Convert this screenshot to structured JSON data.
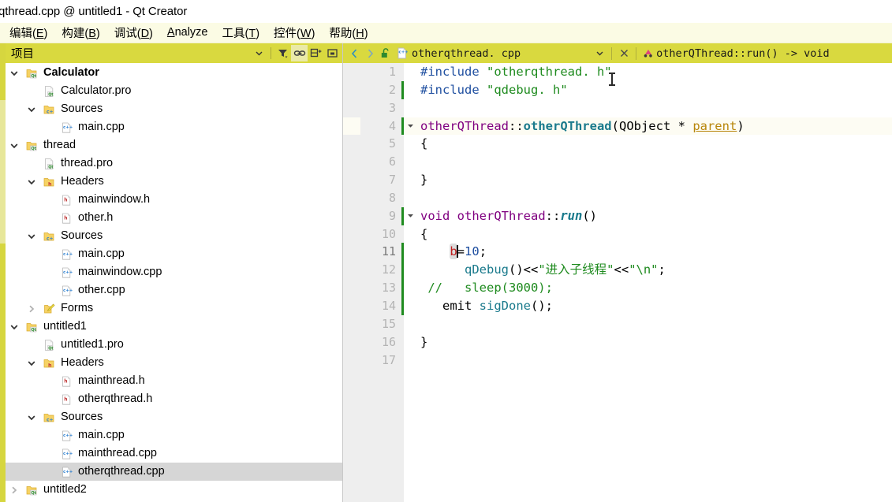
{
  "window": {
    "title": "qthread.cpp @ untitled1 - Qt Creator"
  },
  "menubar": {
    "items": [
      {
        "label": "编辑(E)",
        "mnemonic": "E"
      },
      {
        "label": "构建(B)",
        "mnemonic": "B"
      },
      {
        "label": "调试(D)",
        "mnemonic": "D"
      },
      {
        "label": "Analyze",
        "mnemonic": "A"
      },
      {
        "label": "工具(T)",
        "mnemonic": "T"
      },
      {
        "label": "控件(W)",
        "mnemonic": "W"
      },
      {
        "label": "帮助(H)",
        "mnemonic": "H"
      }
    ]
  },
  "project_panel": {
    "header": {
      "title": "项目",
      "buttons": [
        {
          "name": "combo-dropdown-icon",
          "glyph": "▾"
        },
        {
          "name": "filter-icon",
          "glyph": "filter"
        },
        {
          "name": "link-icon",
          "glyph": "link",
          "active": true
        },
        {
          "name": "expand-all-icon",
          "glyph": "expand"
        },
        {
          "name": "collapse-all-icon",
          "glyph": "collapse"
        }
      ]
    },
    "tree": [
      {
        "label": "Calculator",
        "level": 1,
        "chevron": "down",
        "icon": "qt-project",
        "bold": true,
        "selected": false
      },
      {
        "label": "Calculator.pro",
        "level": 2,
        "chevron": "none",
        "icon": "pro-file",
        "bold": false,
        "selected": false
      },
      {
        "label": "Sources",
        "level": 2,
        "chevron": "down",
        "icon": "folder-cpp",
        "bold": false,
        "selected": false
      },
      {
        "label": "main.cpp",
        "level": 3,
        "chevron": "none",
        "icon": "cpp-file",
        "bold": false,
        "selected": false
      },
      {
        "label": "thread",
        "level": 1,
        "chevron": "down",
        "icon": "qt-project",
        "bold": false,
        "selected": false
      },
      {
        "label": "thread.pro",
        "level": 2,
        "chevron": "none",
        "icon": "pro-file",
        "bold": false,
        "selected": false
      },
      {
        "label": "Headers",
        "level": 2,
        "chevron": "down",
        "icon": "folder-h",
        "bold": false,
        "selected": false
      },
      {
        "label": "mainwindow.h",
        "level": 3,
        "chevron": "none",
        "icon": "h-file",
        "bold": false,
        "selected": false
      },
      {
        "label": "other.h",
        "level": 3,
        "chevron": "none",
        "icon": "h-file",
        "bold": false,
        "selected": false
      },
      {
        "label": "Sources",
        "level": 2,
        "chevron": "down",
        "icon": "folder-cpp",
        "bold": false,
        "selected": false
      },
      {
        "label": "main.cpp",
        "level": 3,
        "chevron": "none",
        "icon": "cpp-file",
        "bold": false,
        "selected": false
      },
      {
        "label": "mainwindow.cpp",
        "level": 3,
        "chevron": "none",
        "icon": "cpp-file",
        "bold": false,
        "selected": false
      },
      {
        "label": "other.cpp",
        "level": 3,
        "chevron": "none",
        "icon": "cpp-file",
        "bold": false,
        "selected": false
      },
      {
        "label": "Forms",
        "level": 2,
        "chevron": "right",
        "icon": "folder-form",
        "bold": false,
        "selected": false
      },
      {
        "label": "untitled1",
        "level": 1,
        "chevron": "down",
        "icon": "qt-project",
        "bold": false,
        "selected": false
      },
      {
        "label": "untitled1.pro",
        "level": 2,
        "chevron": "none",
        "icon": "pro-file",
        "bold": false,
        "selected": false
      },
      {
        "label": "Headers",
        "level": 2,
        "chevron": "down",
        "icon": "folder-h",
        "bold": false,
        "selected": false
      },
      {
        "label": "mainthread.h",
        "level": 3,
        "chevron": "none",
        "icon": "h-file",
        "bold": false,
        "selected": false
      },
      {
        "label": "otherqthread.h",
        "level": 3,
        "chevron": "none",
        "icon": "h-file",
        "bold": false,
        "selected": false
      },
      {
        "label": "Sources",
        "level": 2,
        "chevron": "down",
        "icon": "folder-cpp",
        "bold": false,
        "selected": false
      },
      {
        "label": "main.cpp",
        "level": 3,
        "chevron": "none",
        "icon": "cpp-file",
        "bold": false,
        "selected": false
      },
      {
        "label": "mainthread.cpp",
        "level": 3,
        "chevron": "none",
        "icon": "cpp-file",
        "bold": false,
        "selected": false
      },
      {
        "label": "otherqthread.cpp",
        "level": 3,
        "chevron": "none",
        "icon": "cpp-file",
        "bold": false,
        "selected": true
      },
      {
        "label": "untitled2",
        "level": 1,
        "chevron": "right",
        "icon": "qt-project",
        "bold": false,
        "selected": false
      }
    ]
  },
  "editor": {
    "tabbar": {
      "nav_back_icon": "chevron-left",
      "nav_forward_icon": "chevron-right",
      "lock_icon": "unlocked-padlock",
      "file_icon": "cpp-file",
      "filename": "otherqthread. cpp",
      "dropdown_glyph": "▾",
      "close_glyph": "✕",
      "symbol_icon": "function-symbol",
      "symbol": "otherQThread::run() -> void"
    },
    "current_line": 11,
    "warning_line": 4,
    "modified_lines": [
      2,
      4,
      9,
      11,
      12,
      13,
      14
    ],
    "fold_lines": [
      4,
      9
    ],
    "highlight_line": 4,
    "lines": [
      {
        "n": 1,
        "tokens": [
          {
            "t": "#include ",
            "c": "t-pre"
          },
          {
            "t": "\"otherqthread. h\"",
            "c": "t-str"
          }
        ]
      },
      {
        "n": 2,
        "tokens": [
          {
            "t": "#include ",
            "c": "t-pre"
          },
          {
            "t": "\"qdebug. h\"",
            "c": "t-str"
          }
        ]
      },
      {
        "n": 3,
        "tokens": []
      },
      {
        "n": 4,
        "tokens": [
          {
            "t": "otherQThread",
            "c": "t-type"
          },
          {
            "t": "::",
            "c": "t-op"
          },
          {
            "t": "otherQThread",
            "c": "t-fn"
          },
          {
            "t": "(",
            "c": "t-op"
          },
          {
            "t": "QObject",
            "c": "t-obj"
          },
          {
            "t": " * ",
            "c": "t-op"
          },
          {
            "t": "parent",
            "c": "t-param"
          },
          {
            "t": ")",
            "c": "t-op"
          }
        ]
      },
      {
        "n": 5,
        "tokens": [
          {
            "t": "{",
            "c": "t-plain"
          }
        ]
      },
      {
        "n": 6,
        "tokens": []
      },
      {
        "n": 7,
        "tokens": [
          {
            "t": "}",
            "c": "t-plain"
          }
        ]
      },
      {
        "n": 8,
        "tokens": []
      },
      {
        "n": 9,
        "tokens": [
          {
            "t": "void ",
            "c": "t-kw"
          },
          {
            "t": "otherQThread",
            "c": "t-type"
          },
          {
            "t": "::",
            "c": "t-op"
          },
          {
            "t": "run",
            "c": "t-fni"
          },
          {
            "t": "()",
            "c": "t-op"
          }
        ]
      },
      {
        "n": 10,
        "tokens": [
          {
            "t": "{",
            "c": "t-plain"
          }
        ]
      },
      {
        "n": 11,
        "tokens": [
          {
            "t": "    ",
            "c": "t-plain"
          },
          {
            "t": "b",
            "c": "t-err",
            "sel": true
          },
          {
            "t": "caret",
            "c": "caret"
          },
          {
            "t": "=",
            "c": "t-op"
          },
          {
            "t": "10",
            "c": "t-num"
          },
          {
            "t": ";",
            "c": "t-op"
          }
        ]
      },
      {
        "n": 12,
        "tokens": [
          {
            "t": "      ",
            "c": "t-plain"
          },
          {
            "t": "qDebug",
            "c": "t-id"
          },
          {
            "t": "()",
            "c": "t-op"
          },
          {
            "t": "<<",
            "c": "t-op"
          },
          {
            "t": "\"进入子线程\"",
            "c": "t-str"
          },
          {
            "t": "<<",
            "c": "t-op"
          },
          {
            "t": "\"\\n\"",
            "c": "t-str"
          },
          {
            "t": ";",
            "c": "t-op"
          }
        ]
      },
      {
        "n": 13,
        "tokens": [
          {
            "t": " //   sleep(3000);",
            "c": "t-cmt"
          }
        ]
      },
      {
        "n": 14,
        "tokens": [
          {
            "t": "   ",
            "c": "t-plain"
          },
          {
            "t": "emit ",
            "c": "t-plain"
          },
          {
            "t": "sigDone",
            "c": "t-id"
          },
          {
            "t": "()",
            "c": "t-op"
          },
          {
            "t": ";",
            "c": "t-op"
          }
        ]
      },
      {
        "n": 15,
        "tokens": []
      },
      {
        "n": 16,
        "tokens": [
          {
            "t": "}",
            "c": "t-plain"
          }
        ]
      },
      {
        "n": 17,
        "tokens": []
      }
    ]
  },
  "colors": {
    "chrome_yellow": "#d9d93f",
    "menu_bg": "#fbfbe4",
    "gutter_bg": "#eeeeee",
    "selection_gray": "#d6d6d6",
    "modified_bar": "#1f8b1f",
    "warning_yellow": "#e8a82a",
    "string_green": "#1f8b1f",
    "keyword_purple": "#800080",
    "error_red": "#c02020"
  }
}
